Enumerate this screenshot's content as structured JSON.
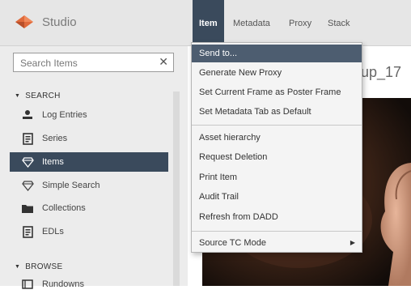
{
  "app": {
    "title": "Studio",
    "accent": "#e06a3b",
    "active_bg": "#3a4a5c"
  },
  "search": {
    "placeholder": "Search Items",
    "value": "",
    "clear_icon": "close-icon"
  },
  "sidebar": {
    "sections": [
      {
        "title": "SEARCH",
        "items": [
          {
            "label": "Log Entries",
            "icon": "log-icon",
            "active": false
          },
          {
            "label": "Series",
            "icon": "document-icon",
            "active": false
          },
          {
            "label": "Items",
            "icon": "diamond-icon",
            "active": true
          },
          {
            "label": "Simple Search",
            "icon": "diamond-icon",
            "active": false
          },
          {
            "label": "Collections",
            "icon": "folder-icon",
            "active": false
          },
          {
            "label": "EDLs",
            "icon": "document-icon",
            "active": false
          }
        ]
      },
      {
        "title": "BROWSE",
        "items": [
          {
            "label": "Rundowns",
            "icon": "list-icon",
            "active": false
          }
        ]
      }
    ]
  },
  "tabs": [
    {
      "label": "Item",
      "active": true
    },
    {
      "label": "Metadata",
      "active": false
    },
    {
      "label": "Proxy",
      "active": false
    },
    {
      "label": "Stack",
      "active": false
    }
  ],
  "content": {
    "asset_title": "up_17"
  },
  "menu": {
    "groups": [
      [
        {
          "label": "Send to...",
          "highlighted": true
        },
        {
          "label": "Generate New Proxy"
        },
        {
          "label": "Set Current Frame as Poster Frame"
        },
        {
          "label": "Set Metadata Tab as Default"
        }
      ],
      [
        {
          "label": "Asset hierarchy"
        },
        {
          "label": "Request Deletion"
        },
        {
          "label": "Print Item"
        },
        {
          "label": "Audit Trail"
        },
        {
          "label": "Refresh from DADD"
        }
      ],
      [
        {
          "label": "Source TC Mode",
          "submenu": true
        }
      ]
    ]
  }
}
